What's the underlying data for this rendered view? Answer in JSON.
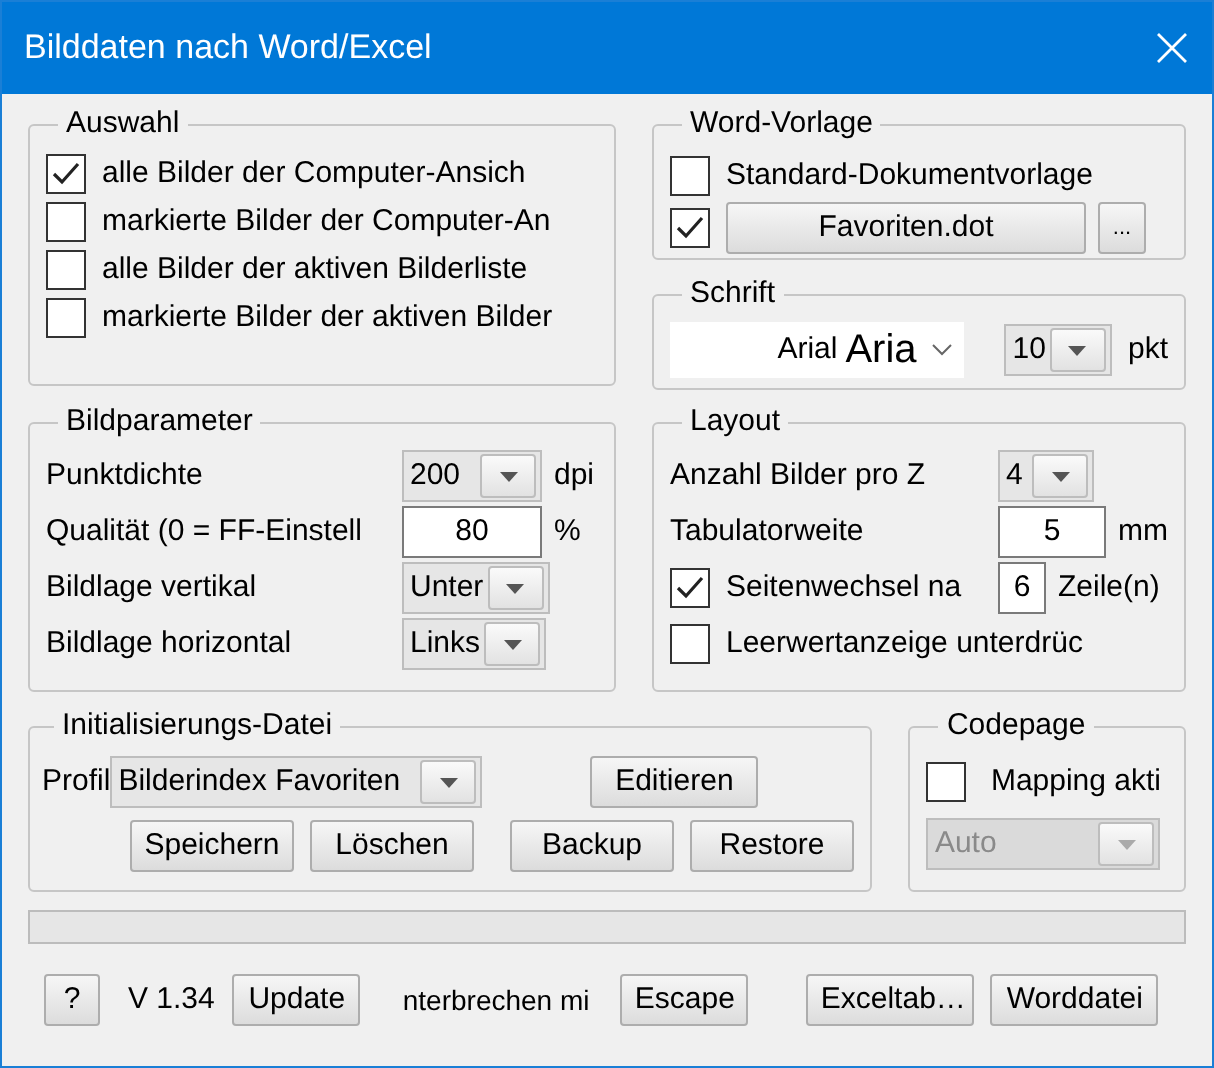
{
  "window": {
    "title": "Bilddaten nach Word/Excel"
  },
  "auswahl": {
    "title": "Auswahl",
    "options": [
      {
        "label": "alle Bilder der Computer-Ansich",
        "checked": true
      },
      {
        "label": "markierte Bilder der Computer-An",
        "checked": false
      },
      {
        "label": "alle Bilder der aktiven Bilderliste",
        "checked": false
      },
      {
        "label": "markierte Bilder der aktiven Bilder",
        "checked": false
      }
    ]
  },
  "word_vorlage": {
    "title": "Word-Vorlage",
    "items": [
      {
        "kind": "label",
        "label": "Standard-Dokumentvorlage",
        "checked": false
      },
      {
        "kind": "button",
        "label": "Favoriten.dot",
        "checked": true,
        "browse": "..."
      }
    ]
  },
  "schrift": {
    "title": "Schrift",
    "font_preview": "Arial",
    "font_value": "Aria",
    "size": "10",
    "unit": "pkt"
  },
  "bildparameter": {
    "title": "Bildparameter",
    "rows": [
      {
        "kind": "combo",
        "label": "Punktdichte",
        "value": "200",
        "unit": "dpi"
      },
      {
        "kind": "input",
        "label": "Qualität (0 = FF-Einstell",
        "value": "80",
        "unit": "%"
      },
      {
        "kind": "combo",
        "label": "Bildlage vertikal",
        "value": "Unter"
      },
      {
        "kind": "combo",
        "label": "Bildlage horizontal",
        "value": "Links"
      }
    ]
  },
  "layout": {
    "title": "Layout",
    "rows": [
      {
        "kind": "combo",
        "label": "Anzahl Bilder pro Z",
        "value": "4"
      },
      {
        "kind": "input",
        "label": "Tabulatorweite",
        "value": "5",
        "unit": "mm"
      },
      {
        "kind": "check_input",
        "label": "Seitenwechsel na",
        "checked": true,
        "value": "6",
        "unit": "Zeile(n)"
      },
      {
        "kind": "check",
        "label": "Leerwertanzeige unterdrüc",
        "checked": false
      }
    ]
  },
  "ini": {
    "title": "Initialisierungs-Datei",
    "profile_label": "Profil",
    "profile": "Bilderindex Favoriten",
    "edit_button": "Editieren",
    "buttons": [
      "Speichern",
      "Löschen",
      "Backup",
      "Restore"
    ]
  },
  "progress": {
    "level": 0
  },
  "codepage": {
    "title": "Codepage",
    "mapping": {
      "label": "Mapping akti",
      "checked": false
    },
    "select": {
      "value": "Auto",
      "disabled": true
    }
  },
  "footer": {
    "help": "?",
    "version": "V 1.34",
    "update": "Update",
    "interrupt_label": "nterbrechen mi",
    "escape": "Escape",
    "buttons": [
      "Exceltab…",
      "Worddatei"
    ]
  }
}
